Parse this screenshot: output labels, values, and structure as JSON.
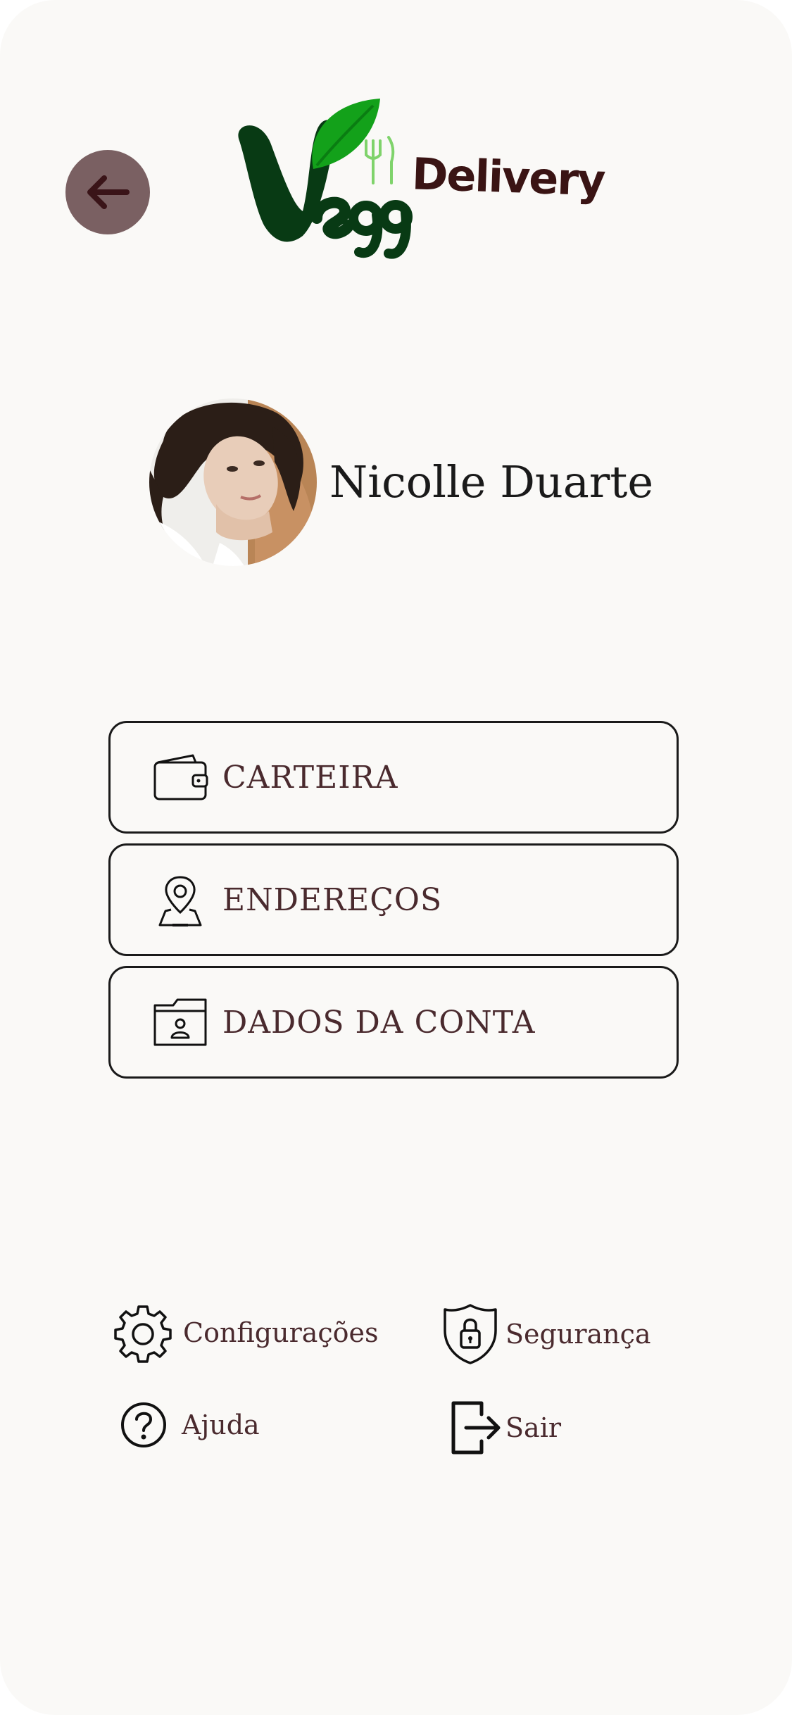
{
  "header": {
    "back_icon": "arrow-left-icon",
    "logo_text": "Delivery"
  },
  "profile": {
    "name": "Nicolle Duarte"
  },
  "menu": {
    "items": [
      {
        "label": "CARTEIRA",
        "icon": "wallet-icon"
      },
      {
        "label": "ENDEREÇOS",
        "icon": "map-pin-icon"
      },
      {
        "label": "DADOS DA CONTA",
        "icon": "account-folder-icon"
      }
    ]
  },
  "links": {
    "settings": "Configurações",
    "security": "Segurança",
    "help": "Ajuda",
    "logout": "Sair"
  },
  "colors": {
    "background": "#faf9f7",
    "back_button": "#7a6062",
    "logo_dark_green": "#083a14",
    "logo_leaf_green": "#13a11a",
    "logo_text": "#3a1414",
    "label_text": "#4a2a2e"
  }
}
